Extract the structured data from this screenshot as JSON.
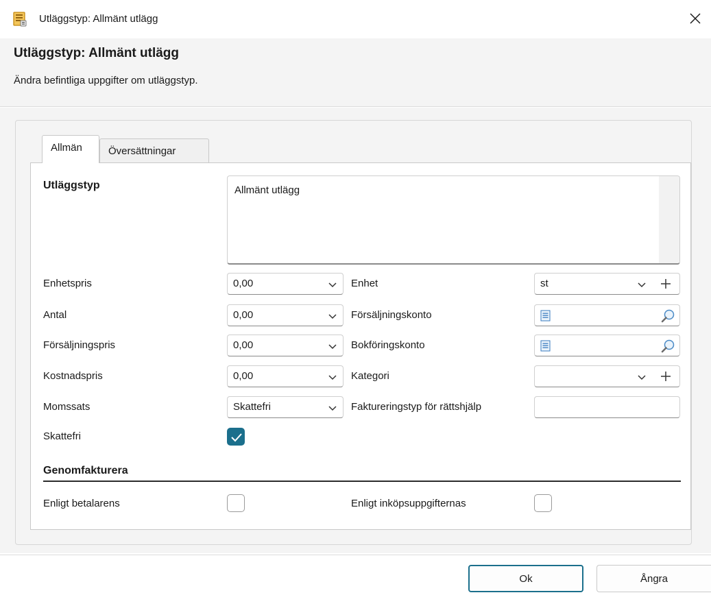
{
  "window": {
    "title": "Utläggstyp: Allmänt utlägg"
  },
  "header": {
    "title": "Utläggstyp: Allmänt utlägg",
    "subtitle": "Ändra befintliga uppgifter om utläggstyp."
  },
  "tabs": [
    {
      "label": "Allmän",
      "active": true
    },
    {
      "label": "Översättningar",
      "active": false
    }
  ],
  "form": {
    "utlaggstyp_label": "Utläggstyp",
    "utlaggstyp_value": "Allmänt utlägg",
    "enhetspris_label": "Enhetspris",
    "enhetspris_value": "0,00",
    "antal_label": "Antal",
    "antal_value": "0,00",
    "forsaljningspris_label": "Försäljningspris",
    "forsaljningspris_value": "0,00",
    "kostnadspris_label": "Kostnadspris",
    "kostnadspris_value": "0,00",
    "momssats_label": "Momssats",
    "momssats_value": "Skattefri",
    "skattefri_label": "Skattefri",
    "skattefri_checked": true,
    "enhet_label": "Enhet",
    "enhet_value": "st",
    "forsaljningskonto_label": "Försäljningskonto",
    "forsaljningskonto_value": "",
    "bokforingskonto_label": "Bokföringskonto",
    "bokforingskonto_value": "",
    "kategori_label": "Kategori",
    "kategori_value": "",
    "faktureringstyp_label": "Faktureringstyp för rättshjälp",
    "faktureringstyp_value": ""
  },
  "genomfakturera": {
    "title": "Genomfakturera",
    "betalarens_label": "Enligt betalarens",
    "betalarens_checked": false,
    "inkop_label": "Enligt inköpsuppgifternas",
    "inkop_checked": false
  },
  "footer": {
    "ok_label": "Ok",
    "cancel_label": "Ångra"
  },
  "colors": {
    "accent": "#1b6f8c",
    "icon_orange": "#e0a020"
  }
}
